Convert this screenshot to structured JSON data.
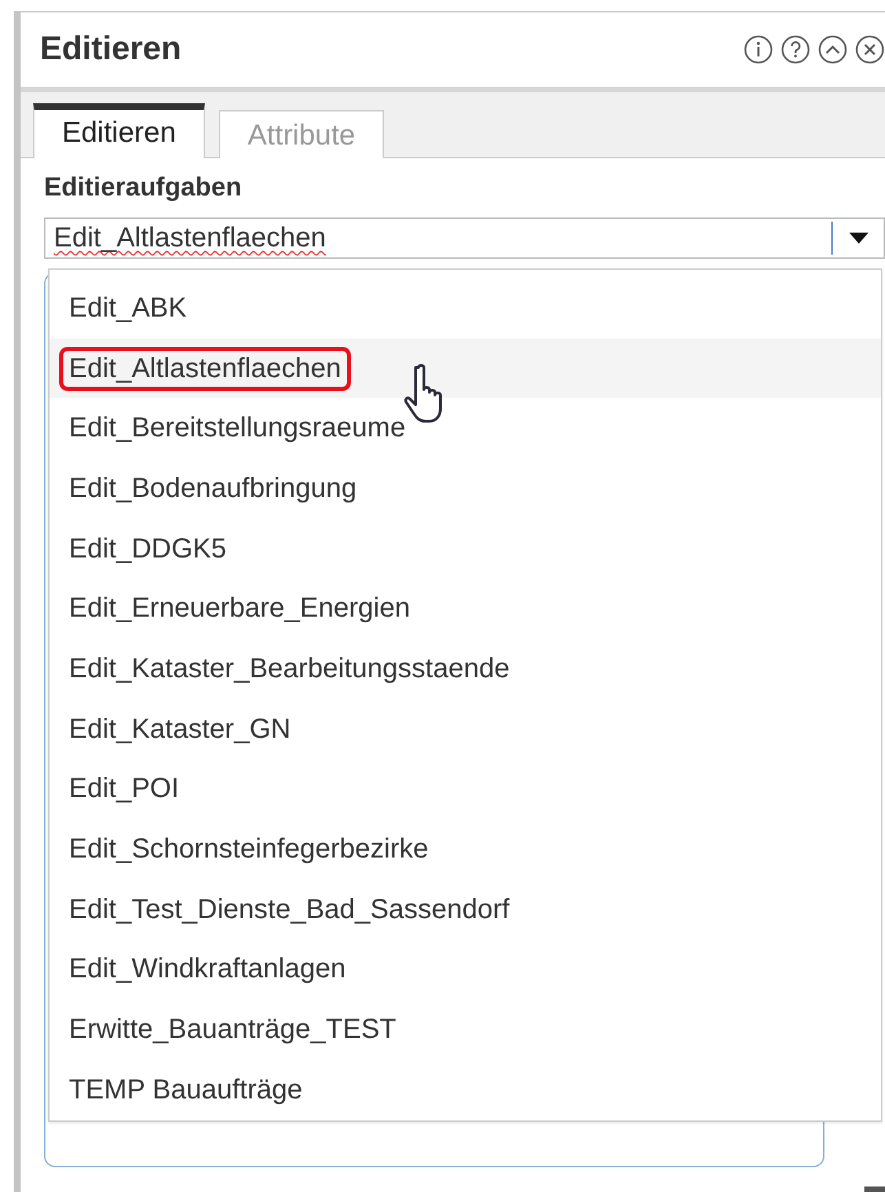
{
  "panel": {
    "title": "Editieren"
  },
  "tabs": [
    {
      "label": "Editieren",
      "selected": true
    },
    {
      "label": "Attribute",
      "selected": false
    }
  ],
  "field_label": "Editieraufgaben",
  "combobox": {
    "value": "Edit_Altlastenflaechen",
    "spellcheck_error": true
  },
  "options": [
    {
      "label": "Edit_ABK",
      "highlighted": false
    },
    {
      "label": "Edit_Altlastenflaechen",
      "highlighted": true
    },
    {
      "label": "Edit_Bereitstellungsraeume",
      "highlighted": false
    },
    {
      "label": "Edit_Bodenaufbringung",
      "highlighted": false
    },
    {
      "label": "Edit_DDGK5",
      "highlighted": false
    },
    {
      "label": "Edit_Erneuerbare_Energien",
      "highlighted": false
    },
    {
      "label": "Edit_Kataster_Bearbeitungsstaende",
      "highlighted": false
    },
    {
      "label": "Edit_Kataster_GN",
      "highlighted": false
    },
    {
      "label": "Edit_POI",
      "highlighted": false
    },
    {
      "label": "Edit_Schornsteinfegerbezirke",
      "highlighted": false
    },
    {
      "label": "Edit_Test_Dienste_Bad_Sassendorf",
      "highlighted": false
    },
    {
      "label": "Edit_Windkraftanlagen",
      "highlighted": false
    },
    {
      "label": "Erwitte_Bauanträge_TEST",
      "highlighted": false
    },
    {
      "label": "TEMP Bauaufträge",
      "highlighted": false
    }
  ]
}
